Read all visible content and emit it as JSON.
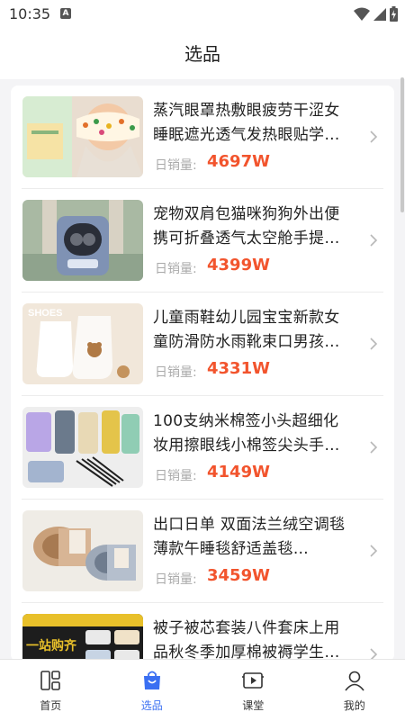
{
  "status": {
    "time": "10:35",
    "notif": "A"
  },
  "header": {
    "title": "选品"
  },
  "products": [
    {
      "title": "蒸汽眼罩热敷眼疲劳干涩女睡眠遮光透气发热眼贴学生…",
      "sales_label": "日销量:",
      "sales_value": "4697W"
    },
    {
      "title": "宠物双肩包猫咪狗狗外出便携可折叠透气太空舱手提防…",
      "sales_label": "日销量:",
      "sales_value": "4399W"
    },
    {
      "title": "儿童雨鞋幼儿园宝宝新款女童防滑防水雨靴束口男孩水…",
      "sales_label": "日销量:",
      "sales_value": "4331W"
    },
    {
      "title": "100支纳米棉签小头超细化妆用擦眼线小棉签尖头手机缝…",
      "sales_label": "日销量:",
      "sales_value": "4149W"
    },
    {
      "title": "出口日单 双面法兰绒空调毯薄款午睡毯舒适盖毯…",
      "sales_label": "日销量:",
      "sales_value": "3459W"
    },
    {
      "title": "被子被芯套装八件套床上用品秋冬季加厚棉被褥学生宿…",
      "sales_label": "",
      "sales_value": ""
    }
  ],
  "thumb_text": {
    "shoes": "SHOES",
    "bag": "Hello Cat",
    "bedding": "一站购齐"
  },
  "nav": {
    "items": [
      {
        "label": "首页",
        "icon": "home-grid-icon"
      },
      {
        "label": "选品",
        "icon": "shopping-bag-icon"
      },
      {
        "label": "课堂",
        "icon": "video-play-icon"
      },
      {
        "label": "我的",
        "icon": "user-icon"
      }
    ],
    "active_color": "#3a6ff2"
  },
  "colors": {
    "accent": "#3a6ff2",
    "price": "#f2542d"
  }
}
